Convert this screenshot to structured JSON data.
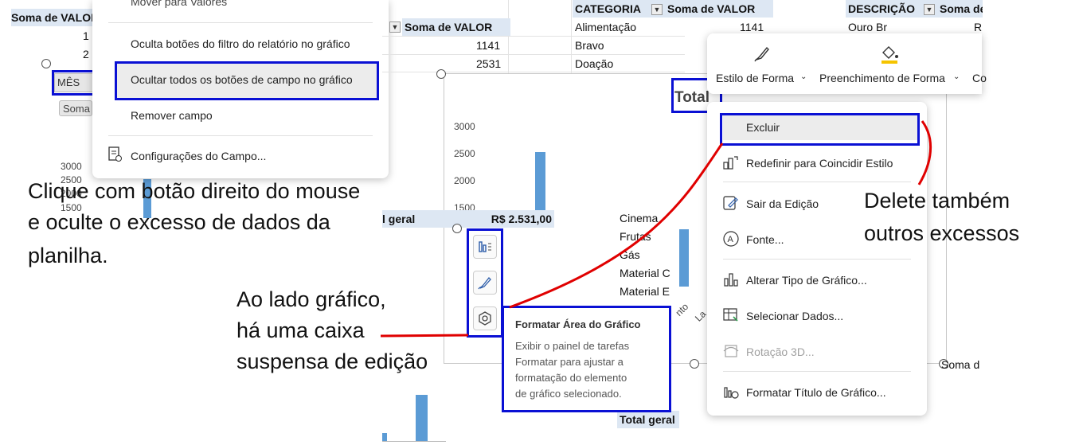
{
  "left_pivot": {
    "header": "Soma de VALOR",
    "values": [
      "1",
      "2"
    ],
    "field_button": "MÊS",
    "series_button": "Soma",
    "ticks": [
      "3000",
      "2500",
      "2000",
      "1500"
    ]
  },
  "context_menu_left": {
    "items": [
      "Mover para Valores",
      "Oculta botões do filtro do relatório no gráfico",
      "Ocultar todos os botões de campo no gráfico",
      "Remover campo",
      "Configurações do Campo..."
    ]
  },
  "mid_pivot": {
    "header": "Soma de VALOR",
    "values": [
      "1141",
      "2531"
    ],
    "total_label": "l geral",
    "total_value": "R$ 2.531,00"
  },
  "category_table": {
    "header_category": "CATEGORIA",
    "header_sum": "Soma de VALOR",
    "rows": [
      {
        "category": "Alimentação",
        "value": "1141"
      },
      {
        "category": "Bravo",
        "value": ""
      },
      {
        "category": "Doação",
        "value": ""
      }
    ],
    "more_rows": [
      "Cinema",
      "Frutas",
      "Gás",
      "Material C",
      "Material E"
    ],
    "grand_total": "Total geral"
  },
  "description_table": {
    "header_description": "DESCRIÇÃO",
    "header_sum": "Soma de",
    "rows": [
      {
        "description": "Ouro Br",
        "value": "R"
      }
    ]
  },
  "chart": {
    "title": "Total",
    "ticks": [
      "3000",
      "2500",
      "2000",
      "1500"
    ],
    "x_labels": [
      "nto",
      "La"
    ]
  },
  "chart_side_buttons": {
    "elements_icon": "chart-elements-icon",
    "styles_icon": "chart-styles-icon",
    "filter_icon": "chart-filters-icon"
  },
  "tooltip": {
    "title": "Formatar Área do Gráfico",
    "body": [
      "Exibir o painel de tarefas",
      "Formatar para ajustar a",
      "formatação do elemento",
      "de gráfico selecionado."
    ]
  },
  "mini_toolbar": {
    "style_label": "Estilo de Forma",
    "fill_label": "Preenchimento de Forma",
    "outline_label": "Co"
  },
  "context_menu_right": {
    "items": [
      "Excluir",
      "Redefinir para Coincidir Estilo",
      "Sair da Edição",
      "Fonte...",
      "Alterar Tipo de Gráfico...",
      "Selecionar Dados...",
      "Rotação 3D...",
      "Formatar Título de Gráfico..."
    ]
  },
  "annotations": {
    "left": [
      "Clique com botão direito do mouse",
      "e oculte o excesso de dados da",
      "planilha."
    ],
    "middle": [
      "Ao lado gráfico,",
      "há uma caixa",
      "suspensa de edição"
    ],
    "right": [
      "Delete também",
      "outros excessos"
    ],
    "bottom_right": "Soma d"
  },
  "colors": {
    "highlight_box": "#0a10d4",
    "arrow": "#e00000",
    "bar": "#5b9bd5",
    "header_fill": "#dde7f3"
  }
}
